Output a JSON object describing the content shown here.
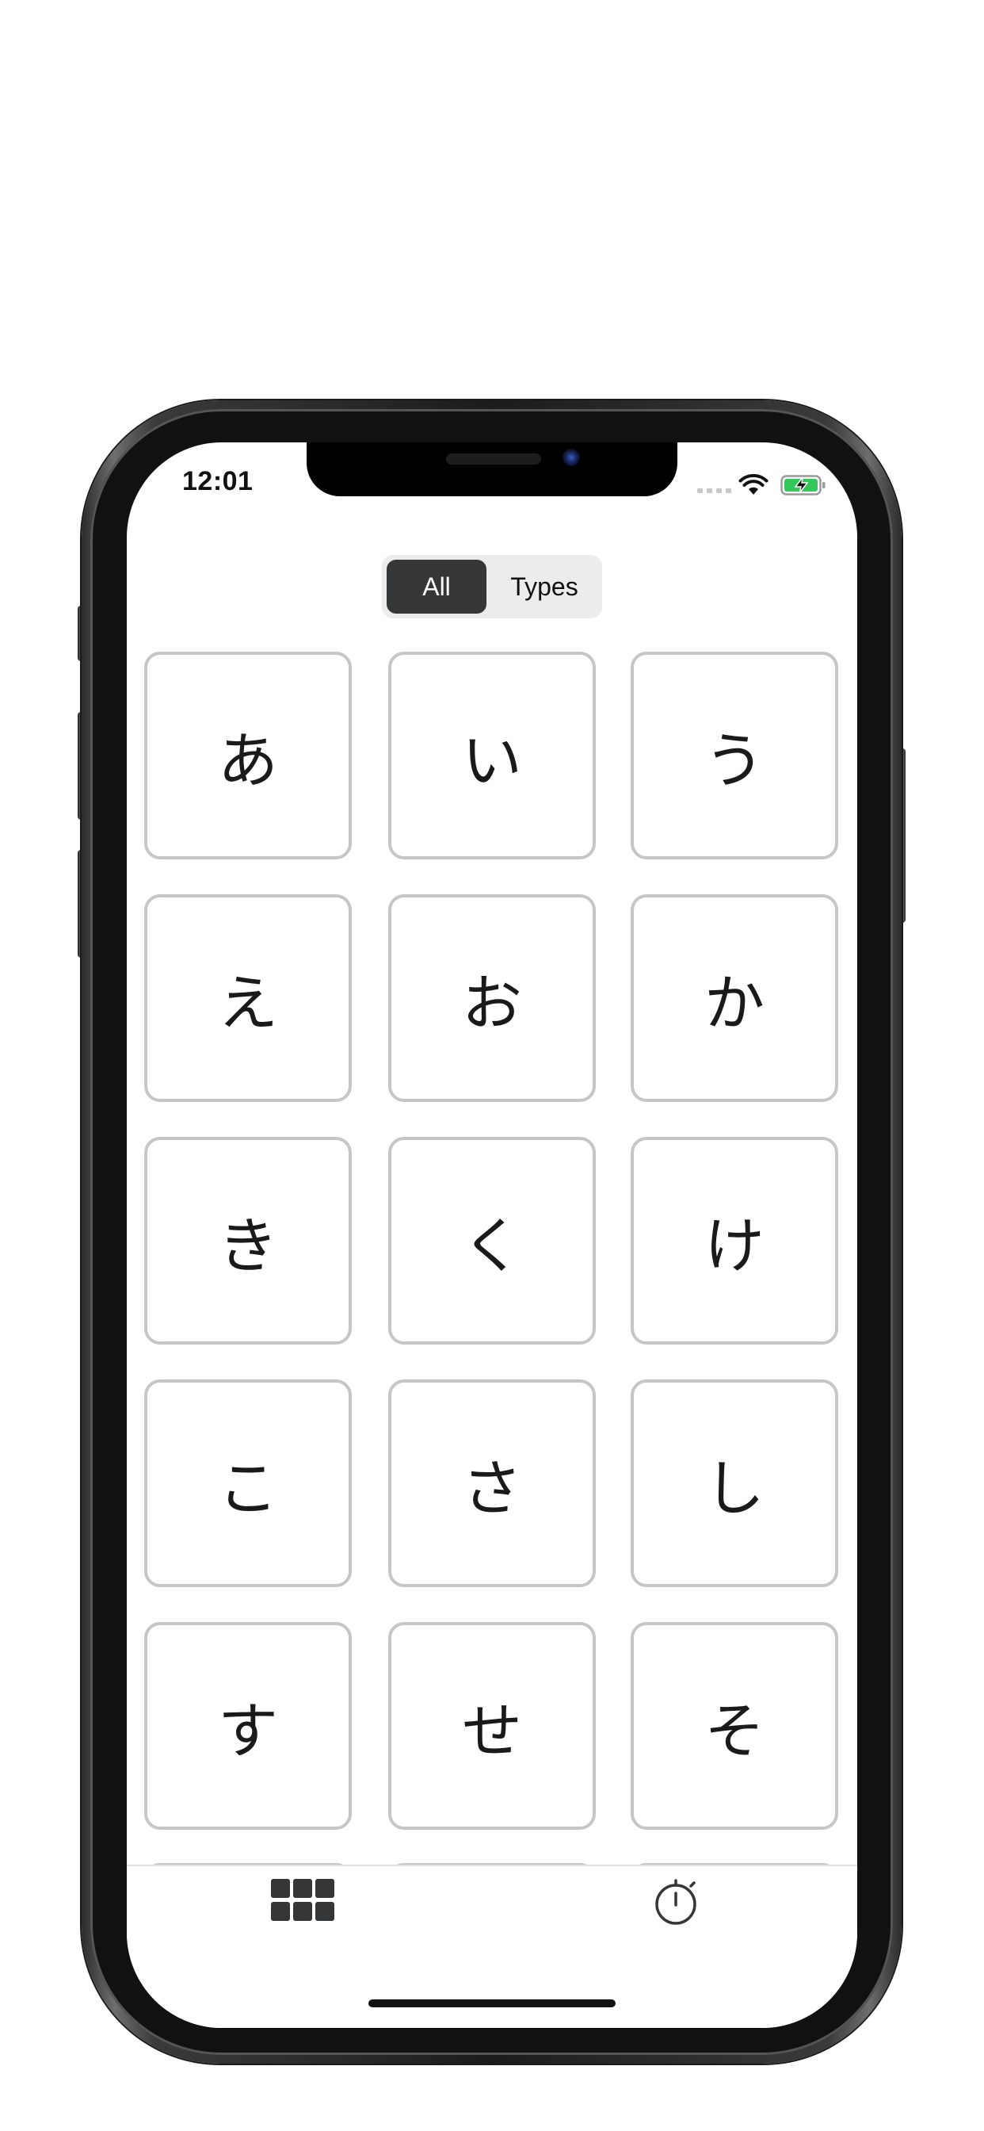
{
  "status_bar": {
    "time": "12:01"
  },
  "segmented_control": {
    "options": [
      "All",
      "Types"
    ],
    "selected": "All"
  },
  "kana": [
    "あ",
    "い",
    "う",
    "え",
    "お",
    "か",
    "き",
    "く",
    "け",
    "こ",
    "さ",
    "し",
    "す",
    "せ",
    "そ"
  ],
  "tab_bar": {
    "tabs": [
      {
        "icon": "grid-icon",
        "selected": true
      },
      {
        "icon": "stopwatch-icon",
        "selected": false
      }
    ]
  },
  "colors": {
    "selected_segment": "#353637",
    "card_border": "#c6c6c6",
    "battery_charge": "#34c759"
  }
}
